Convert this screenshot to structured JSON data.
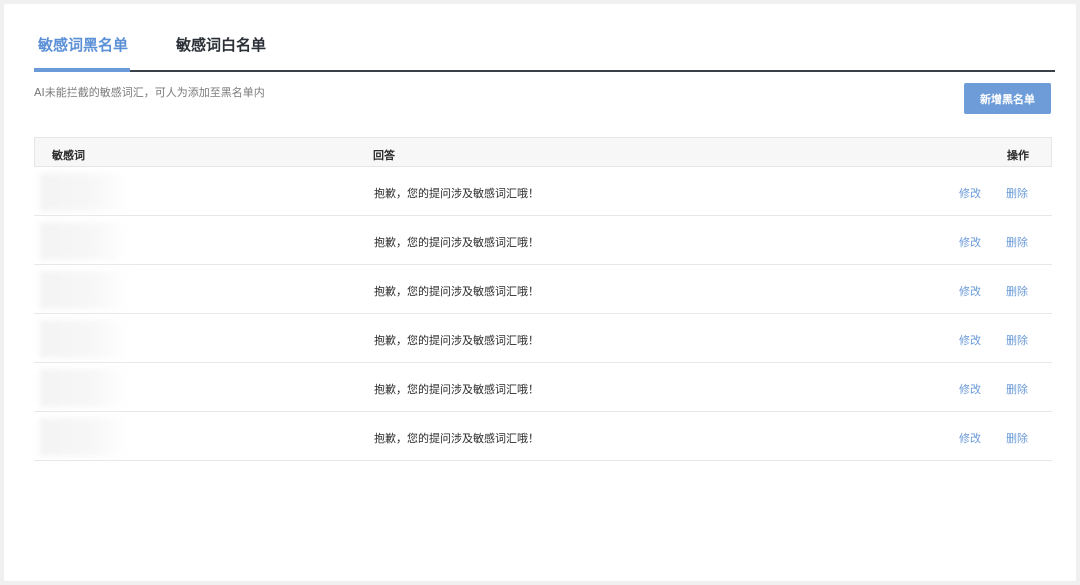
{
  "tabs": [
    {
      "label": "敏感词黑名单",
      "active": true
    },
    {
      "label": "敏感词白名单",
      "active": false
    }
  ],
  "hint": "AI未能拦截的敏感词汇，可人为添加至黑名单内",
  "add_button": "新增黑名单",
  "table": {
    "headers": {
      "word": "敏感词",
      "answer": "回答",
      "ops": "操作"
    },
    "rows": [
      {
        "answer": "抱歉，您的提问涉及敏感词汇哦！",
        "edit": "修改",
        "delete": "删除"
      },
      {
        "answer": "抱歉，您的提问涉及敏感词汇哦！",
        "edit": "修改",
        "delete": "删除"
      },
      {
        "answer": "抱歉，您的提问涉及敏感词汇哦！",
        "edit": "修改",
        "delete": "删除"
      },
      {
        "answer": "抱歉，您的提问涉及敏感词汇哦！",
        "edit": "修改",
        "delete": "删除"
      },
      {
        "answer": "抱歉，您的提问涉及敏感词汇哦！",
        "edit": "修改",
        "delete": "删除"
      },
      {
        "answer": "抱歉，您的提问涉及敏感词汇哦！",
        "edit": "修改",
        "delete": "删除"
      }
    ]
  },
  "colors": {
    "accent": "#6a9ad8",
    "button": "#6d9cd9",
    "tab_rule": "#3a4048"
  }
}
